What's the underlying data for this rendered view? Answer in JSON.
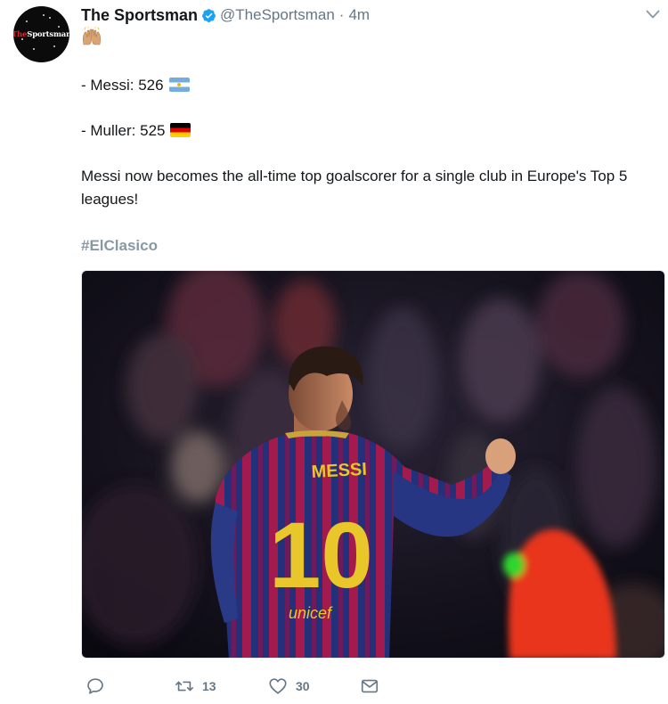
{
  "tweet": {
    "display_name": "The Sportsman",
    "handle": "@TheSportsman",
    "separator": "·",
    "time": "4m",
    "avatar": {
      "text_red": "The",
      "text_white": "Sportsman"
    },
    "emoji": "raising-hands-emoji",
    "lines": {
      "messi": "- Messi: 526",
      "muller": "- Muller: 525",
      "main": "Messi now becomes the all-time top goalscorer for a single club in Europe's Top 5 leagues!"
    },
    "hashtag": "#ElClasico",
    "media": {
      "shirt_name": "MESSI",
      "shirt_number": "10",
      "sponsor": "unicef"
    },
    "actions": {
      "reply_icon": "reply-icon",
      "retweet_count": "13",
      "like_count": "30",
      "dm_icon": "envelope-icon"
    }
  },
  "colors": {
    "text": "#14171a",
    "secondary": "#657786",
    "hashtag": "#8899a6",
    "verified": "#1da1f2"
  }
}
